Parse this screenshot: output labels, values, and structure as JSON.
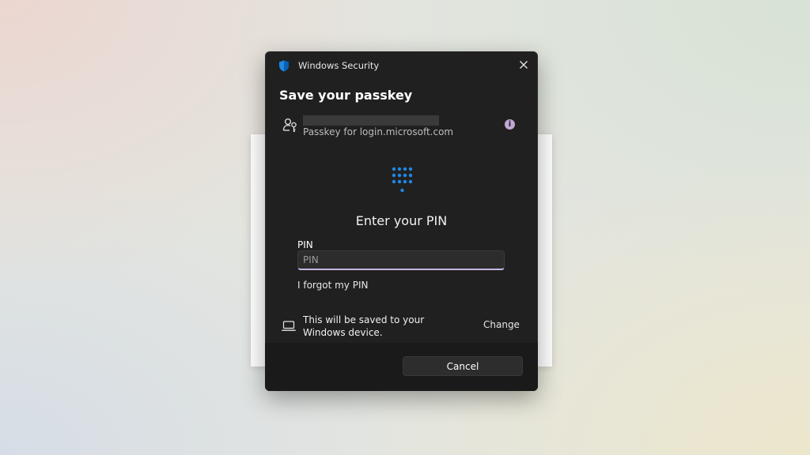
{
  "window": {
    "app_title": "Windows Security",
    "heading": "Save your passkey"
  },
  "account": {
    "passkey_site": "Passkey for login.microsoft.com",
    "info_glyph": "i"
  },
  "pin": {
    "prompt": "Enter your PIN",
    "label": "PIN",
    "value": "",
    "placeholder": "PIN",
    "forgot_link": "I forgot my PIN"
  },
  "storage": {
    "note": "This will be saved to your Windows device.",
    "change_link": "Change"
  },
  "footer": {
    "cancel_label": "Cancel"
  },
  "icons": {
    "shield": "shield-icon",
    "close": "close-icon",
    "account": "account-key-icon",
    "info": "info-icon",
    "pin_pad": "pin-pad-icon",
    "laptop": "laptop-icon"
  },
  "colors": {
    "dialog_bg": "#202020",
    "footer_bg": "#1a1a1a",
    "accent_blue": "#1e88e5",
    "input_focus_underline": "#c8b6e2",
    "info_badge": "#c2a6d6"
  }
}
